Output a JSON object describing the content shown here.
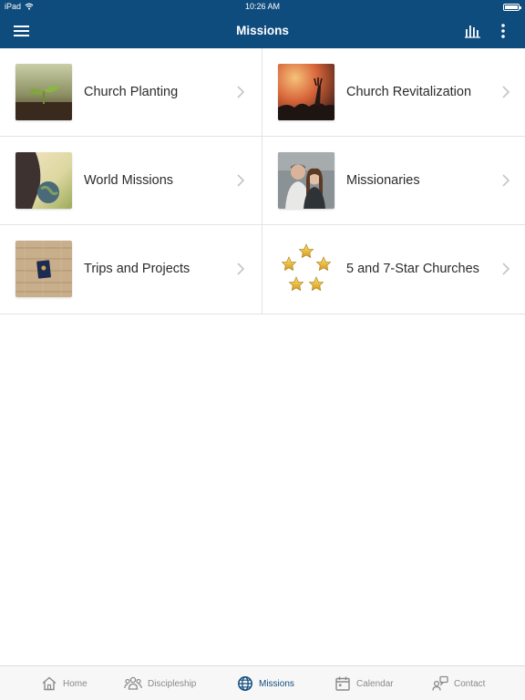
{
  "status_bar": {
    "device": "iPad",
    "time": "10:26 AM"
  },
  "nav": {
    "title": "Missions"
  },
  "items": [
    {
      "label": "Church Planting",
      "image": "seedling-in-soil-photo"
    },
    {
      "label": "Church Revitalization",
      "image": "worship-crowd-photo"
    },
    {
      "label": "World Missions",
      "image": "globe-in-hand-photo"
    },
    {
      "label": "Missionaries",
      "image": "missionary-couple-photo"
    },
    {
      "label": "Trips and Projects",
      "image": "passport-on-wood-photo"
    },
    {
      "label": "5 and 7-Star Churches",
      "image": "five-gold-stars-icon"
    }
  ],
  "tabs": [
    {
      "label": "Home",
      "icon": "home-icon",
      "active": false
    },
    {
      "label": "Discipleship",
      "icon": "people-icon",
      "active": false
    },
    {
      "label": "Missions",
      "icon": "globe-icon",
      "active": true
    },
    {
      "label": "Calendar",
      "icon": "calendar-icon",
      "active": false
    },
    {
      "label": "Contact",
      "icon": "contact-icon",
      "active": false
    }
  ],
  "colors": {
    "brand": "#0f4c7e",
    "inactive_tab": "#8a8a8a",
    "divider": "#e3e3e3"
  }
}
